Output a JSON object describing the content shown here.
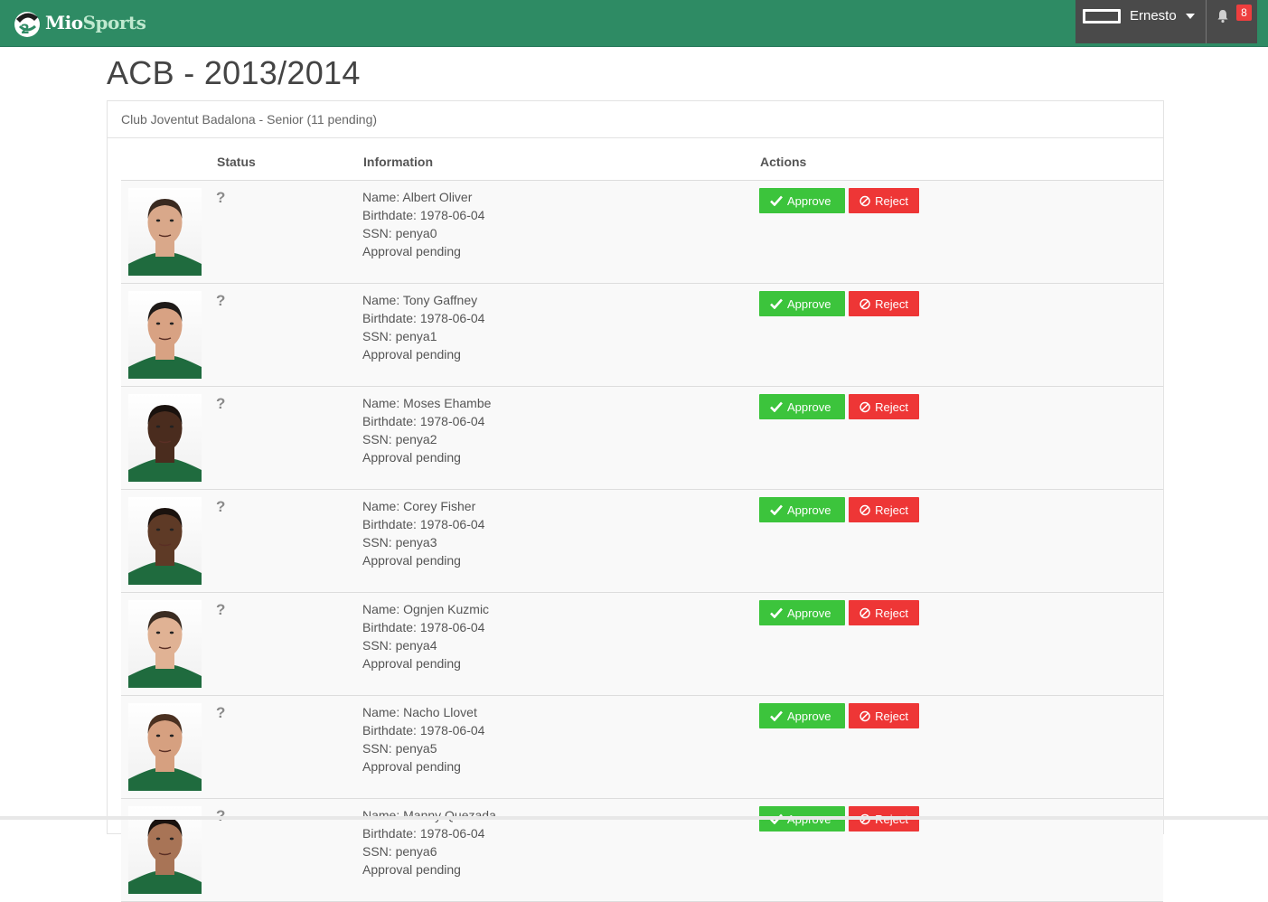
{
  "header": {
    "brand_prefix": "Mio",
    "brand_suffix": "Sports",
    "user_name": "Ernesto",
    "notification_count": "8"
  },
  "page": {
    "title": "ACB - 2013/2014",
    "panel_heading": "Club Joventut Badalona - Senior (11 pending)"
  },
  "table": {
    "headers": {
      "status": "Status",
      "information": "Information",
      "actions": "Actions"
    },
    "status_symbol": "?",
    "approve_label": "Approve",
    "reject_label": "Reject",
    "rows": [
      {
        "name": "Name: Albert Oliver",
        "birthdate": "Birthdate: 1978-06-04",
        "ssn": "SSN: penya0",
        "state": "Approval pending",
        "skin": "#d9a88a",
        "hair": "#3a2a20"
      },
      {
        "name": "Name: Tony Gaffney",
        "birthdate": "Birthdate: 1978-06-04",
        "ssn": "SSN: penya1",
        "state": "Approval pending",
        "skin": "#d8a283",
        "hair": "#1e1a18"
      },
      {
        "name": "Name: Moses Ehambe",
        "birthdate": "Birthdate: 1978-06-04",
        "ssn": "SSN: penya2",
        "state": "Approval pending",
        "skin": "#4a2c1e",
        "hair": "#1a120e"
      },
      {
        "name": "Name: Corey Fisher",
        "birthdate": "Birthdate: 1978-06-04",
        "ssn": "SSN: penya3",
        "state": "Approval pending",
        "skin": "#5e3a26",
        "hair": "#1a120e"
      },
      {
        "name": "Name: Ognjen Kuzmic",
        "birthdate": "Birthdate: 1978-06-04",
        "ssn": "SSN: penya4",
        "state": "Approval pending",
        "skin": "#e0b294",
        "hair": "#3a2c22"
      },
      {
        "name": "Name: Nacho Llovet",
        "birthdate": "Birthdate: 1978-06-04",
        "ssn": "SSN: penya5",
        "state": "Approval pending",
        "skin": "#d6a080",
        "hair": "#4a3020"
      },
      {
        "name": "Name: Manny Quezada",
        "birthdate": "Birthdate: 1978-06-04",
        "ssn": "SSN: penya6",
        "state": "Approval pending",
        "skin": "#a87456",
        "hair": "#1a120e"
      }
    ]
  },
  "colors": {
    "navbar": "#2e8b64",
    "approve": "#3cc43c",
    "reject": "#ee3636",
    "jersey": "#1f6b3e"
  }
}
